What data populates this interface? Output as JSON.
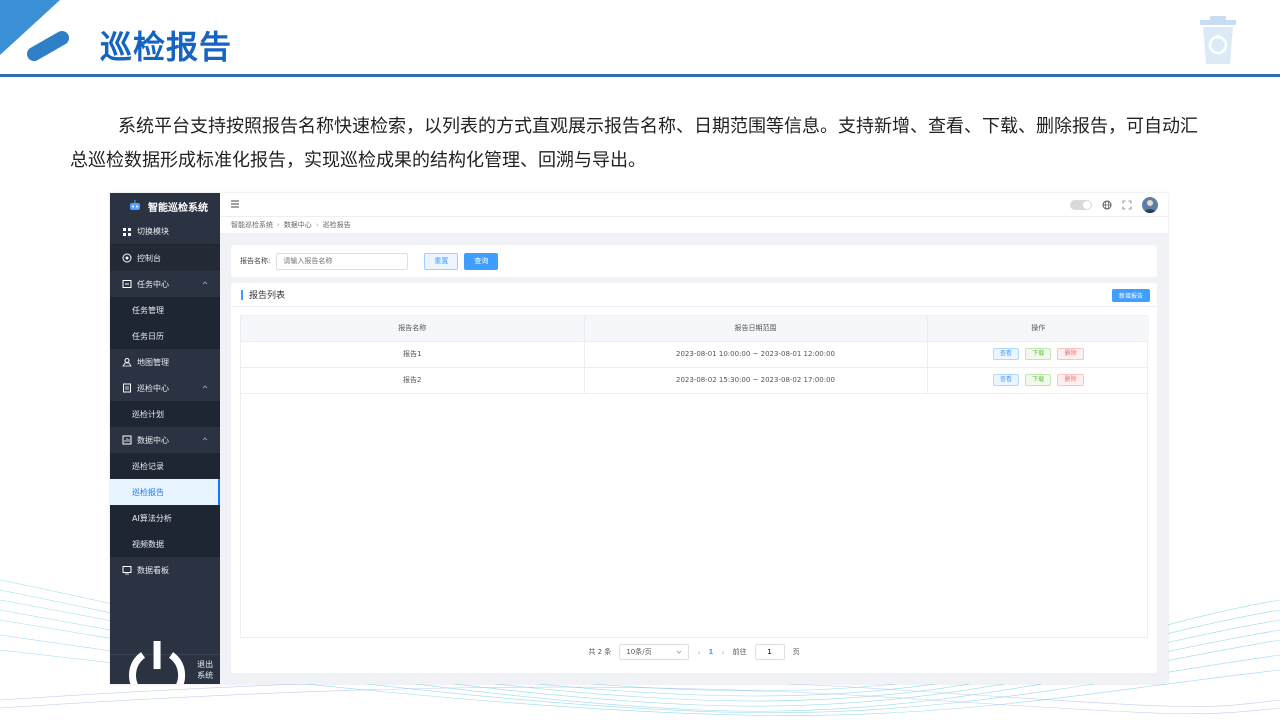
{
  "slide": {
    "title": "巡检报告",
    "description": "系统平台支持按照报告名称快速检索，以列表的方式直观展示报告名称、日期范围等信息。支持新增、查看、下载、删除报告，可自动汇总巡检数据形成标准化报告，实现巡检成果的结构化管理、回溯与导出。"
  },
  "colors": {
    "accent": "#1565c0",
    "primary": "#409eff",
    "sidebar": "#2b3342"
  },
  "app": {
    "sidebar": {
      "logo": "智能巡检系统",
      "switch_module": "切换模块",
      "console": "控制台",
      "task_center": "任务中心",
      "task_manage": "任务管理",
      "task_calendar": "任务日历",
      "map_manage": "地图管理",
      "patrol_center": "巡检中心",
      "patrol_plan": "巡检计划",
      "data_center": "数据中心",
      "patrol_record": "巡检记录",
      "patrol_report": "巡检报告",
      "ai_analysis": "AI算法分析",
      "video_data": "视频数据",
      "data_board": "数据看板",
      "logout": "退出系统"
    },
    "breadcrumb": [
      "智能巡检系统",
      "数据中心",
      "巡检报告"
    ],
    "search": {
      "label": "报告名称:",
      "placeholder": "请输入报告名称",
      "reset": "重置",
      "query": "查询"
    },
    "list": {
      "title": "报告列表",
      "add_button": "新增报告",
      "columns": [
        "报告名称",
        "报告日期范围",
        "操作"
      ],
      "rows": [
        {
          "name": "报告1",
          "range": "2023-08-01 10:00:00 ~ 2023-08-01 12:00:00"
        },
        {
          "name": "报告2",
          "range": "2023-08-02 15:30:00 ~ 2023-08-02 17:00:00"
        }
      ],
      "actions": {
        "view": "查看",
        "download": "下载",
        "delete": "删除"
      }
    },
    "pagination": {
      "total": "共 2 条",
      "page_size": "10条/页",
      "prev": "‹",
      "current_page": "1",
      "next": "›",
      "goto_prefix": "前往",
      "goto_value": "1",
      "goto_suffix": "页"
    }
  }
}
